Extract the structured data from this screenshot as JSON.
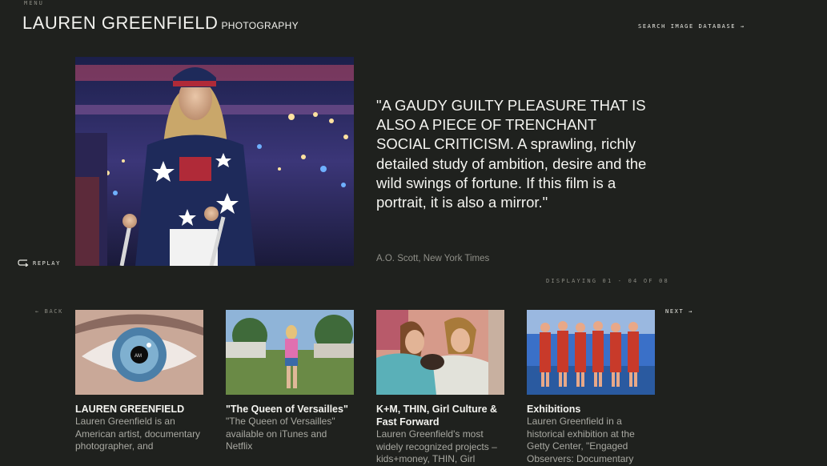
{
  "header": {
    "menu_label": "MENU",
    "brand_name": "LAUREN GREENFIELD",
    "brand_sub": "PHOTOGRAPHY",
    "search_label": "SEARCH IMAGE DATABASE →"
  },
  "feature": {
    "quote": "\"A GAUDY GUILTY PLEASURE THAT IS ALSO A PIECE OF TRENCHANT SOCIAL CRITICISM. A sprawling, richly detailed study of ambition, desire and the wild swings of fortune. If this film is a portrait, it is also a mirror.\"",
    "citation": "A.O. Scott, New York Times",
    "replay_label": "REPLAY",
    "displaying": "DISPLAYING 01 - 04 OF 08"
  },
  "carousel": {
    "back_label": "← BACK",
    "next_label": "NEXT →",
    "cards": [
      {
        "title": "LAUREN GREENFIELD",
        "desc": "Lauren Greenfield is an American artist, documentary photographer, and"
      },
      {
        "title": "\"The Queen of Versailles\"",
        "desc": "\"The Queen of Versailles\" available on iTunes and Netflix"
      },
      {
        "title": "K+M, THIN, Girl Culture & Fast Forward",
        "desc": "Lauren Greenfield's most widely recognized projects – kids+money, THIN, Girl"
      },
      {
        "title": "Exhibitions",
        "desc": "Lauren Greenfield in a historical exhibition at the Getty Center, \"Engaged Observers: Documentary"
      }
    ]
  },
  "colors": {
    "background": "#1f211e",
    "text": "#f4f4f0",
    "muted": "#8f8f88"
  },
  "icons": [
    "replay-arrow-icon",
    "arrow-left-icon",
    "arrow-right-icon"
  ]
}
